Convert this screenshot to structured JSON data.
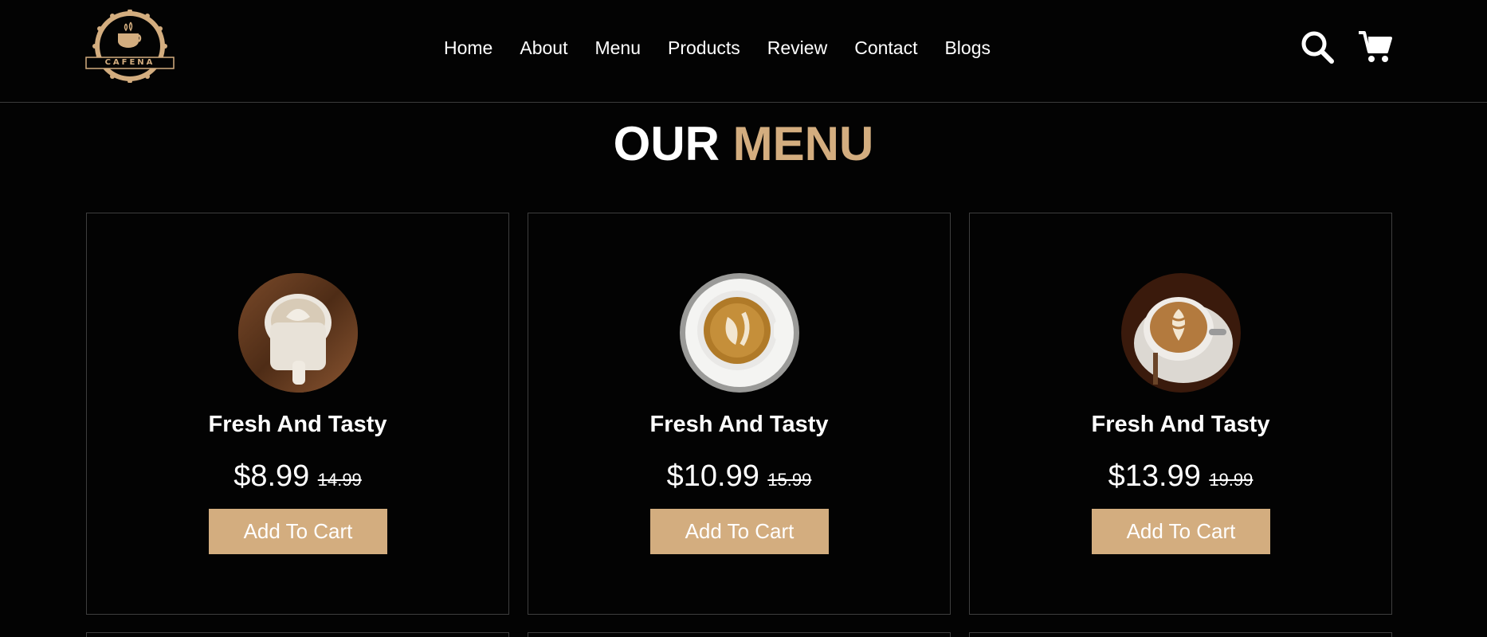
{
  "brand": {
    "name": "CAFENA",
    "accent": "#d3ad7f"
  },
  "nav": {
    "items": [
      "Home",
      "About",
      "Menu",
      "Products",
      "Review",
      "Contact",
      "Blogs"
    ]
  },
  "header_icons": {
    "search": "search-icon",
    "cart": "cart-icon"
  },
  "section": {
    "title_part1": "OUR",
    "title_part2": "MENU"
  },
  "menu": [
    {
      "title": "Fresh And Tasty",
      "price": "$8.99",
      "old_price": "14.99",
      "button": "Add To Cart",
      "image": "latte-mug-photo"
    },
    {
      "title": "Fresh And Tasty",
      "price": "$10.99",
      "old_price": "15.99",
      "button": "Add To Cart",
      "image": "latte-art-cup-photo"
    },
    {
      "title": "Fresh And Tasty",
      "price": "$13.99",
      "old_price": "19.99",
      "button": "Add To Cart",
      "image": "cappuccino-saucer-photo"
    }
  ]
}
